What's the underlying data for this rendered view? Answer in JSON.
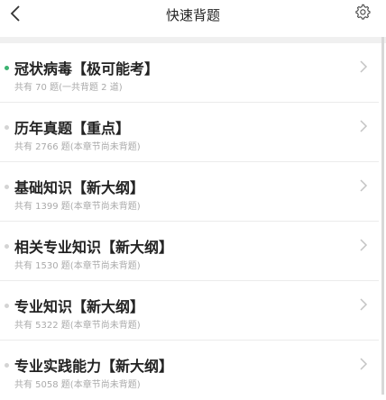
{
  "header": {
    "title": "快速背题",
    "back_icon": "chevron-left-icon",
    "settings_icon": "gear-icon"
  },
  "colors": {
    "active_dot": "#3cb371",
    "inactive_dot": "#d4d4d4",
    "subtitle": "#aaaaaa"
  },
  "items": [
    {
      "title": "冠状病毒【极可能考】",
      "subtitle": "共有 70 题(一共背题 2 道)",
      "active": true
    },
    {
      "title": "历年真题【重点】",
      "subtitle": "共有 2766 题(本章节尚未背题)",
      "active": false
    },
    {
      "title": "基础知识【新大纲】",
      "subtitle": "共有 1399 题(本章节尚未背题)",
      "active": false
    },
    {
      "title": "相关专业知识【新大纲】",
      "subtitle": "共有 1530 题(本章节尚未背题)",
      "active": false
    },
    {
      "title": "专业知识【新大纲】",
      "subtitle": "共有 5322 题(本章节尚未背题)",
      "active": false
    },
    {
      "title": "专业实践能力【新大纲】",
      "subtitle": "共有 5058 题(本章节尚未背题)",
      "active": false
    }
  ]
}
